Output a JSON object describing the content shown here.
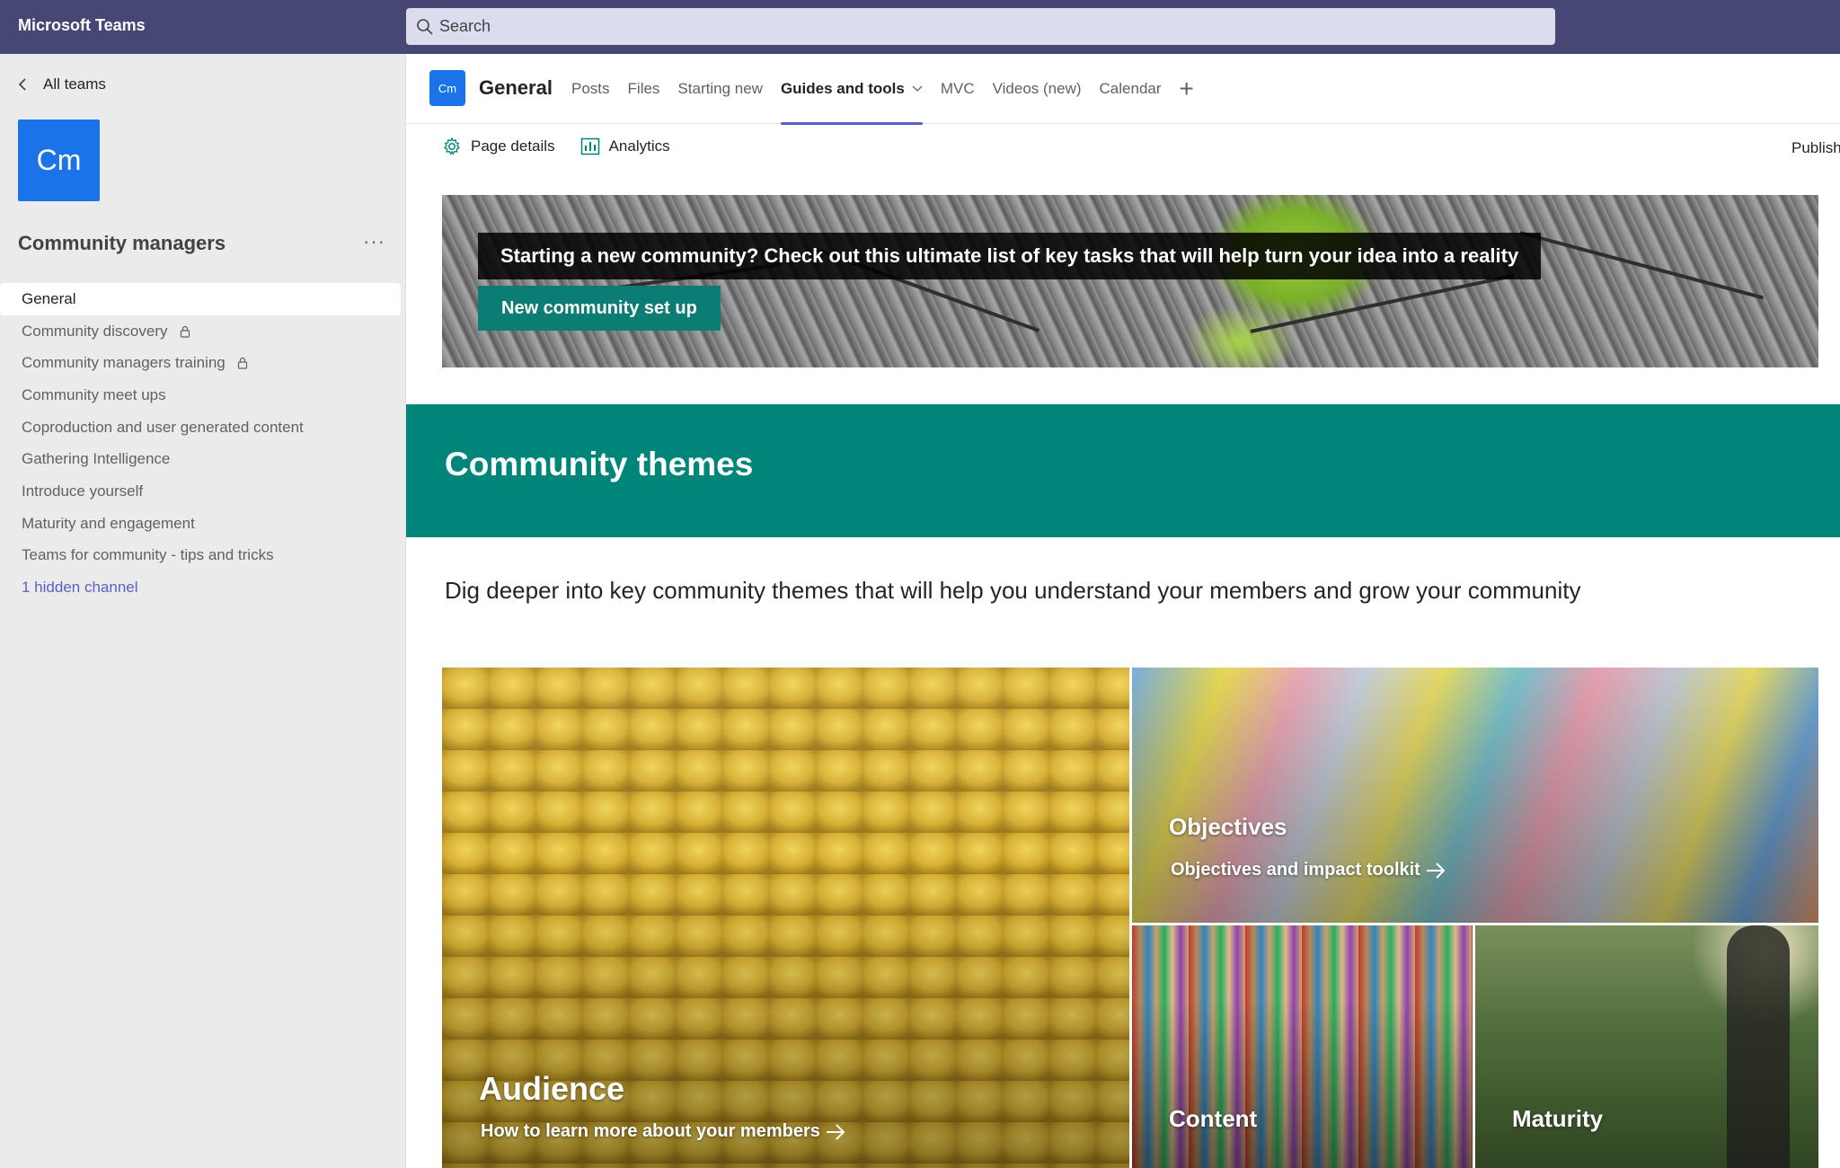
{
  "app": {
    "title": "Microsoft Teams"
  },
  "search": {
    "placeholder": "Search"
  },
  "sidebar": {
    "back_label": "All teams",
    "team": {
      "initials": "Cm",
      "name": "Community managers",
      "more": "···"
    },
    "channels": [
      {
        "label": "General",
        "active": true
      },
      {
        "label": "Community discovery",
        "locked": true
      },
      {
        "label": "Community managers training",
        "locked": true
      },
      {
        "label": "Community meet ups"
      },
      {
        "label": "Coproduction and user generated content"
      },
      {
        "label": "Gathering Intelligence"
      },
      {
        "label": "Introduce yourself"
      },
      {
        "label": "Maturity and engagement"
      },
      {
        "label": "Teams for community - tips and tricks"
      },
      {
        "label": "1 hidden channel",
        "link": true
      }
    ]
  },
  "channel": {
    "initials": "Cm",
    "title": "General",
    "tabs": [
      {
        "label": "Posts"
      },
      {
        "label": "Files"
      },
      {
        "label": "Starting new"
      },
      {
        "label": "Guides and tools",
        "active": true,
        "dropdown": true
      },
      {
        "label": "MVC"
      },
      {
        "label": "Videos (new)"
      },
      {
        "label": "Calendar"
      }
    ],
    "add_tab": "+"
  },
  "page_actions": {
    "details": "Page details",
    "analytics": "Analytics",
    "publish": "Publish"
  },
  "banner": {
    "text": "Starting a new community? Check out this ultimate list of key tasks that will help turn your idea into a reality",
    "button": "New community set up"
  },
  "themes": {
    "title": "Community themes",
    "subtitle": "Dig deeper into key community themes that will help you understand your members and grow your community"
  },
  "tiles": {
    "audience": {
      "title": "Audience",
      "link": "How to learn more about your members"
    },
    "objectives": {
      "title": "Objectives",
      "link": "Objectives and impact toolkit"
    },
    "content": {
      "title": "Content"
    },
    "maturity": {
      "title": "Maturity"
    }
  },
  "colors": {
    "topbar": "#464775",
    "accent": "#5b5fc7",
    "teal": "#00857a",
    "avatar": "#1a73e8"
  }
}
